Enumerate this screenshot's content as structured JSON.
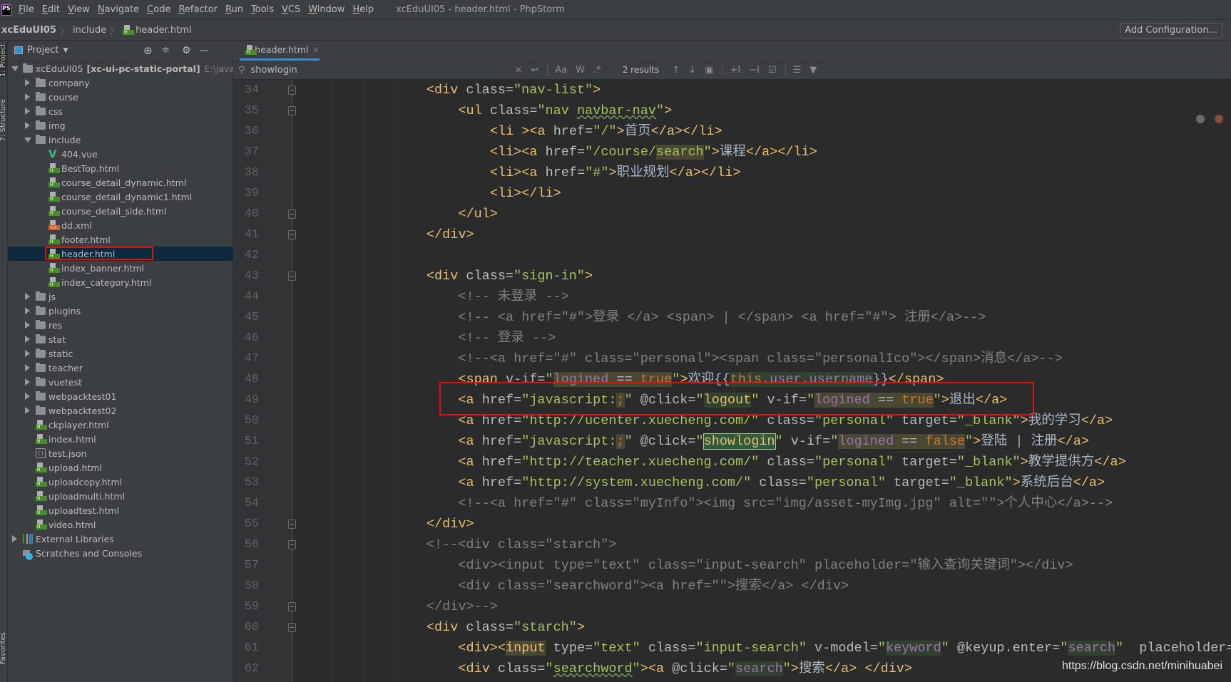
{
  "menubar": {
    "items": [
      "File",
      "Edit",
      "View",
      "Navigate",
      "Code",
      "Refactor",
      "Run",
      "Tools",
      "VCS",
      "Window",
      "Help"
    ],
    "title": "xcEduUI05 - header.html - PhpStorm",
    "logo": "PS"
  },
  "breadcrumb": {
    "project": "xcEduUI05",
    "folder": "include",
    "file": "header.html"
  },
  "add_configuration": "Add Configuration...",
  "side_tabs": {
    "project": "1: Project",
    "structure": "7: Structure",
    "favorites": "Favorites"
  },
  "project_panel": {
    "title": "Project",
    "tree": [
      {
        "name": "xcEduUI05",
        "extra": "[xc-ui-pc-static-portal]",
        "path": "E:\\java_www",
        "depth": 0,
        "type": "folder",
        "state": "open"
      },
      {
        "name": "company",
        "depth": 1,
        "type": "folder",
        "state": "closed"
      },
      {
        "name": "course",
        "depth": 1,
        "type": "folder",
        "state": "closed"
      },
      {
        "name": "css",
        "depth": 1,
        "type": "folder",
        "state": "closed"
      },
      {
        "name": "img",
        "depth": 1,
        "type": "folder",
        "state": "closed"
      },
      {
        "name": "include",
        "depth": 1,
        "type": "folder",
        "state": "open"
      },
      {
        "name": "404.vue",
        "depth": 2,
        "type": "vue"
      },
      {
        "name": "BestTop.html",
        "depth": 2,
        "type": "html"
      },
      {
        "name": "course_detail_dynamic.html",
        "depth": 2,
        "type": "html"
      },
      {
        "name": "course_detail_dynamic1.html",
        "depth": 2,
        "type": "html"
      },
      {
        "name": "course_detail_side.html",
        "depth": 2,
        "type": "html"
      },
      {
        "name": "dd.xml",
        "depth": 2,
        "type": "xml"
      },
      {
        "name": "footer.html",
        "depth": 2,
        "type": "html"
      },
      {
        "name": "header.html",
        "depth": 2,
        "type": "html",
        "selected": true
      },
      {
        "name": "index_banner.html",
        "depth": 2,
        "type": "html"
      },
      {
        "name": "index_category.html",
        "depth": 2,
        "type": "html"
      },
      {
        "name": "js",
        "depth": 1,
        "type": "folder",
        "state": "closed"
      },
      {
        "name": "plugins",
        "depth": 1,
        "type": "folder",
        "state": "closed"
      },
      {
        "name": "res",
        "depth": 1,
        "type": "folder",
        "state": "closed"
      },
      {
        "name": "stat",
        "depth": 1,
        "type": "folder",
        "state": "closed"
      },
      {
        "name": "static",
        "depth": 1,
        "type": "folder",
        "state": "closed"
      },
      {
        "name": "teacher",
        "depth": 1,
        "type": "folder",
        "state": "closed"
      },
      {
        "name": "vuetest",
        "depth": 1,
        "type": "folder",
        "state": "closed"
      },
      {
        "name": "webpacktest01",
        "depth": 1,
        "type": "folder",
        "state": "closed"
      },
      {
        "name": "webpacktest02",
        "depth": 1,
        "type": "folder",
        "state": "closed"
      },
      {
        "name": "ckplayer.html",
        "depth": 1,
        "type": "html"
      },
      {
        "name": "index.html",
        "depth": 1,
        "type": "html"
      },
      {
        "name": "test.json",
        "depth": 1,
        "type": "json"
      },
      {
        "name": "upload.html",
        "depth": 1,
        "type": "html"
      },
      {
        "name": "uploadcopy.html",
        "depth": 1,
        "type": "html"
      },
      {
        "name": "uploadmulti.html",
        "depth": 1,
        "type": "html"
      },
      {
        "name": "uploadtest.html",
        "depth": 1,
        "type": "html"
      },
      {
        "name": "video.html",
        "depth": 1,
        "type": "html"
      },
      {
        "name": "External Libraries",
        "depth": 0,
        "type": "lib",
        "state": "closed"
      },
      {
        "name": "Scratches and Consoles",
        "depth": 0,
        "type": "scratch"
      }
    ]
  },
  "editor": {
    "tab": "header.html",
    "find": {
      "query": "showlogin",
      "results": "2 results",
      "match_case": "Aa",
      "words": "W",
      "regex": ".*"
    },
    "lines": [
      {
        "n": 34,
        "i": 16,
        "f": 1,
        "tk": [
          [
            "<div ",
            "t"
          ],
          [
            "class=",
            "a"
          ],
          [
            "\"nav-list\"",
            "v"
          ],
          [
            ">",
            "t"
          ]
        ]
      },
      {
        "n": 35,
        "i": 20,
        "f": 1,
        "tk": [
          [
            "<ul ",
            "t"
          ],
          [
            "class=",
            "a"
          ],
          [
            "\"nav ",
            "v"
          ],
          [
            "navbar-nav",
            "v sq"
          ],
          [
            "\"",
            "v"
          ],
          [
            ">",
            "t"
          ]
        ]
      },
      {
        "n": 36,
        "i": 24,
        "tk": [
          [
            "<li ><a ",
            "t"
          ],
          [
            "href=",
            "a"
          ],
          [
            "\"/\"",
            "v"
          ],
          [
            ">",
            "t"
          ],
          [
            "首页",
            "x"
          ],
          [
            "</a></li>",
            "t"
          ]
        ]
      },
      {
        "n": 37,
        "i": 24,
        "tk": [
          [
            "<li><a ",
            "t"
          ],
          [
            "href=",
            "a"
          ],
          [
            "\"/course/",
            "v"
          ],
          [
            "search",
            "v js"
          ],
          [
            "\"",
            "v"
          ],
          [
            ">",
            "t"
          ],
          [
            "课程",
            "x"
          ],
          [
            "</a></li>",
            "t"
          ]
        ]
      },
      {
        "n": 38,
        "i": 24,
        "tk": [
          [
            "<li><a ",
            "t"
          ],
          [
            "href=",
            "a"
          ],
          [
            "\"#\"",
            "v"
          ],
          [
            ">",
            "t"
          ],
          [
            "职业规划",
            "x"
          ],
          [
            "</a></li>",
            "t"
          ]
        ]
      },
      {
        "n": 39,
        "i": 24,
        "tk": [
          [
            "<li></li>",
            "t"
          ]
        ]
      },
      {
        "n": 40,
        "i": 20,
        "f": 2,
        "tk": [
          [
            "</ul>",
            "t"
          ]
        ]
      },
      {
        "n": 41,
        "i": 16,
        "f": 2,
        "tk": [
          [
            "</div>",
            "t"
          ]
        ]
      },
      {
        "n": 42,
        "i": 0,
        "tk": []
      },
      {
        "n": 43,
        "i": 16,
        "f": 1,
        "tk": [
          [
            "<div ",
            "t"
          ],
          [
            "class=",
            "a"
          ],
          [
            "\"sign-in\"",
            "v"
          ],
          [
            ">",
            "t"
          ]
        ]
      },
      {
        "n": 44,
        "i": 20,
        "tk": [
          [
            "<!-- 未登录 -->",
            "c"
          ]
        ]
      },
      {
        "n": 45,
        "i": 20,
        "tk": [
          [
            "<!-- <a href=\"#\">登录 </a> <span> | </span> <a href=\"#\"> 注册</a>-->",
            "c"
          ]
        ]
      },
      {
        "n": 46,
        "i": 20,
        "tk": [
          [
            "<!-- 登录 -->",
            "c"
          ]
        ]
      },
      {
        "n": 47,
        "i": 20,
        "tk": [
          [
            "<!--<a href=\"#\" class=\"personal\"><span class=\"personalIco\"></span>消息</a>-->",
            "c"
          ]
        ]
      },
      {
        "n": 48,
        "i": 20,
        "tk": [
          [
            "<span ",
            "t"
          ],
          [
            "v-if=",
            "a"
          ],
          [
            "\"",
            "v"
          ],
          [
            "logined",
            "p js"
          ],
          [
            " == ",
            "x js"
          ],
          [
            "true",
            "k js"
          ],
          [
            "\"",
            "v"
          ],
          [
            ">",
            "t"
          ],
          [
            "欢迎{{",
            "x"
          ],
          [
            "this",
            "k hl"
          ],
          [
            ".user.username",
            "p hl"
          ],
          [
            "}}",
            "x"
          ],
          [
            "</span>",
            "t"
          ]
        ]
      },
      {
        "n": 49,
        "i": 20,
        "tk": [
          [
            "<a ",
            "t"
          ],
          [
            "href=",
            "a"
          ],
          [
            "\"javascript:",
            "v"
          ],
          [
            ";",
            "k js"
          ],
          [
            "\" ",
            "v"
          ],
          [
            "@click=",
            "a"
          ],
          [
            "\"",
            "v"
          ],
          [
            "logout",
            "t hl"
          ],
          [
            "\" ",
            "v"
          ],
          [
            "v-if=",
            "a"
          ],
          [
            "\"",
            "v"
          ],
          [
            "logined",
            "p js"
          ],
          [
            " == ",
            "x js"
          ],
          [
            "true",
            "k js"
          ],
          [
            "\"",
            "v"
          ],
          [
            ">",
            "t"
          ],
          [
            "退出",
            "x"
          ],
          [
            "</a>",
            "t"
          ]
        ]
      },
      {
        "n": 50,
        "i": 20,
        "tk": [
          [
            "<a ",
            "t"
          ],
          [
            "href=",
            "a"
          ],
          [
            "\"http://ucenter.xuecheng.com/\" ",
            "v"
          ],
          [
            "class=",
            "a"
          ],
          [
            "\"personal\" ",
            "v"
          ],
          [
            "target=",
            "a"
          ],
          [
            "\"_blank\"",
            "v"
          ],
          [
            ">",
            "t"
          ],
          [
            "我的学习",
            "x"
          ],
          [
            "</a>",
            "t"
          ]
        ]
      },
      {
        "n": 51,
        "i": 20,
        "tk": [
          [
            "<a ",
            "t"
          ],
          [
            "href=",
            "a"
          ],
          [
            "\"javascript:",
            "v"
          ],
          [
            ";",
            "k js"
          ],
          [
            "\" ",
            "v"
          ],
          [
            "@click=",
            "a"
          ],
          [
            "\"",
            "v"
          ],
          [
            "showlogin",
            "t occ"
          ],
          [
            "\" ",
            "v"
          ],
          [
            "v-if=",
            "a"
          ],
          [
            "\"",
            "v"
          ],
          [
            "logined",
            "p js"
          ],
          [
            " == ",
            "x js"
          ],
          [
            "false",
            "k js"
          ],
          [
            "\"",
            "v"
          ],
          [
            ">",
            "t"
          ],
          [
            "登陆 | 注册",
            "x"
          ],
          [
            "</a>",
            "t"
          ]
        ]
      },
      {
        "n": 52,
        "i": 20,
        "tk": [
          [
            "<a ",
            "t"
          ],
          [
            "href=",
            "a"
          ],
          [
            "\"http://teacher.xuecheng.com/\" ",
            "v"
          ],
          [
            "class=",
            "a"
          ],
          [
            "\"personal\" ",
            "v"
          ],
          [
            "target=",
            "a"
          ],
          [
            "\"_blank\"",
            "v"
          ],
          [
            ">",
            "t"
          ],
          [
            "教学提供方",
            "x"
          ],
          [
            "</a>",
            "t"
          ]
        ]
      },
      {
        "n": 53,
        "i": 20,
        "tk": [
          [
            "<a ",
            "t"
          ],
          [
            "href=",
            "a"
          ],
          [
            "\"http://system.xuecheng.com/\" ",
            "v"
          ],
          [
            "class=",
            "a"
          ],
          [
            "\"personal\" ",
            "v"
          ],
          [
            "target=",
            "a"
          ],
          [
            "\"_blank\"",
            "v"
          ],
          [
            ">",
            "t"
          ],
          [
            "系统后台",
            "x"
          ],
          [
            "</a>",
            "t"
          ]
        ]
      },
      {
        "n": 54,
        "i": 20,
        "tk": [
          [
            "<!--<a href=\"#\" class=\"myInfo\"><img src=\"img/asset-myImg.jpg\" alt=\"\">个人中心</a>-->",
            "c"
          ]
        ]
      },
      {
        "n": 55,
        "i": 16,
        "f": 2,
        "tk": [
          [
            "</div>",
            "t"
          ]
        ]
      },
      {
        "n": 56,
        "i": 16,
        "f": 1,
        "tk": [
          [
            "<!--<div class=\"starch\">",
            "c"
          ]
        ]
      },
      {
        "n": 57,
        "i": 20,
        "tk": [
          [
            "<div><input type=\"text\" class=\"input-search\" placeholder=\"输入查询关键词\"></div>",
            "c"
          ]
        ]
      },
      {
        "n": 58,
        "i": 20,
        "tk": [
          [
            "<div class=\"searchword\"><a href=\"\">搜索</a> </div>",
            "c"
          ]
        ]
      },
      {
        "n": 59,
        "i": 16,
        "f": 2,
        "tk": [
          [
            "</div>-->",
            "c"
          ]
        ]
      },
      {
        "n": 60,
        "i": 16,
        "f": 1,
        "tk": [
          [
            "<div ",
            "t"
          ],
          [
            "class=",
            "a"
          ],
          [
            "\"starch\"",
            "v"
          ],
          [
            ">",
            "t"
          ]
        ]
      },
      {
        "n": 61,
        "i": 20,
        "tk": [
          [
            "<div><",
            "t"
          ],
          [
            "input",
            "t js"
          ],
          [
            " ",
            "x"
          ],
          [
            "type=",
            "a"
          ],
          [
            "\"text\" ",
            "v"
          ],
          [
            "class=",
            "a"
          ],
          [
            "\"input-search\" ",
            "v"
          ],
          [
            "v-model=",
            "a"
          ],
          [
            "\"",
            "v"
          ],
          [
            "keyword",
            "p hl"
          ],
          [
            "\" ",
            "v"
          ],
          [
            "@keyup.enter=",
            "a"
          ],
          [
            "\"",
            "v"
          ],
          [
            "search",
            "p hl"
          ],
          [
            "\"  ",
            "v"
          ],
          [
            "placeholder=\"",
            "a"
          ]
        ]
      },
      {
        "n": 62,
        "i": 20,
        "tk": [
          [
            "<div ",
            "t"
          ],
          [
            "class=",
            "a"
          ],
          [
            "\"",
            "v"
          ],
          [
            "searchword",
            "v sq"
          ],
          [
            "\"",
            "v"
          ],
          [
            "><a ",
            "t"
          ],
          [
            "@click=",
            "a"
          ],
          [
            "\"",
            "v"
          ],
          [
            "search",
            "p hl"
          ],
          [
            "\"",
            "v"
          ],
          [
            ">",
            "t"
          ],
          [
            "搜索",
            "x"
          ],
          [
            "</a> </div>",
            "t"
          ]
        ]
      }
    ]
  },
  "watermark": "https://blog.csdn.net/minihuabei"
}
